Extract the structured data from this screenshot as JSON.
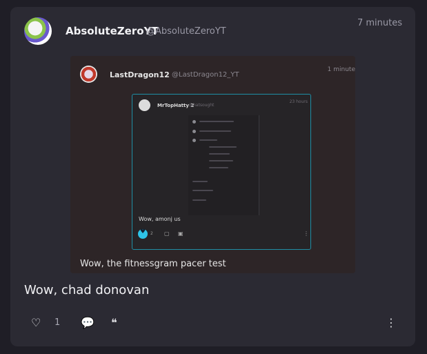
{
  "post": {
    "username": "AbsoluteZeroYT",
    "handle": "@AbsoluteZeroYT",
    "timestamp": "7 minutes",
    "text": "Wow, chad donovan",
    "like_count": "1",
    "embed": {
      "username": "LastDragon12",
      "handle": "@LastDragon12_YT",
      "timestamp": "1 minute",
      "text": "Wow, the fitnessgram pacer test",
      "embed": {
        "username": "MrTopHatty 2",
        "handle": "@hatsought",
        "timestamp": "23 hours",
        "text": "Wow, amonj us",
        "like_count": "2"
      }
    }
  },
  "icons": {
    "like": "heart-icon",
    "reply": "comment-icon",
    "quote": "quote-icon",
    "more": "more-vertical-icon"
  },
  "colors": {
    "background": "#1f1e26",
    "card": "#2b2a33",
    "accent": "#2ec4e8"
  }
}
